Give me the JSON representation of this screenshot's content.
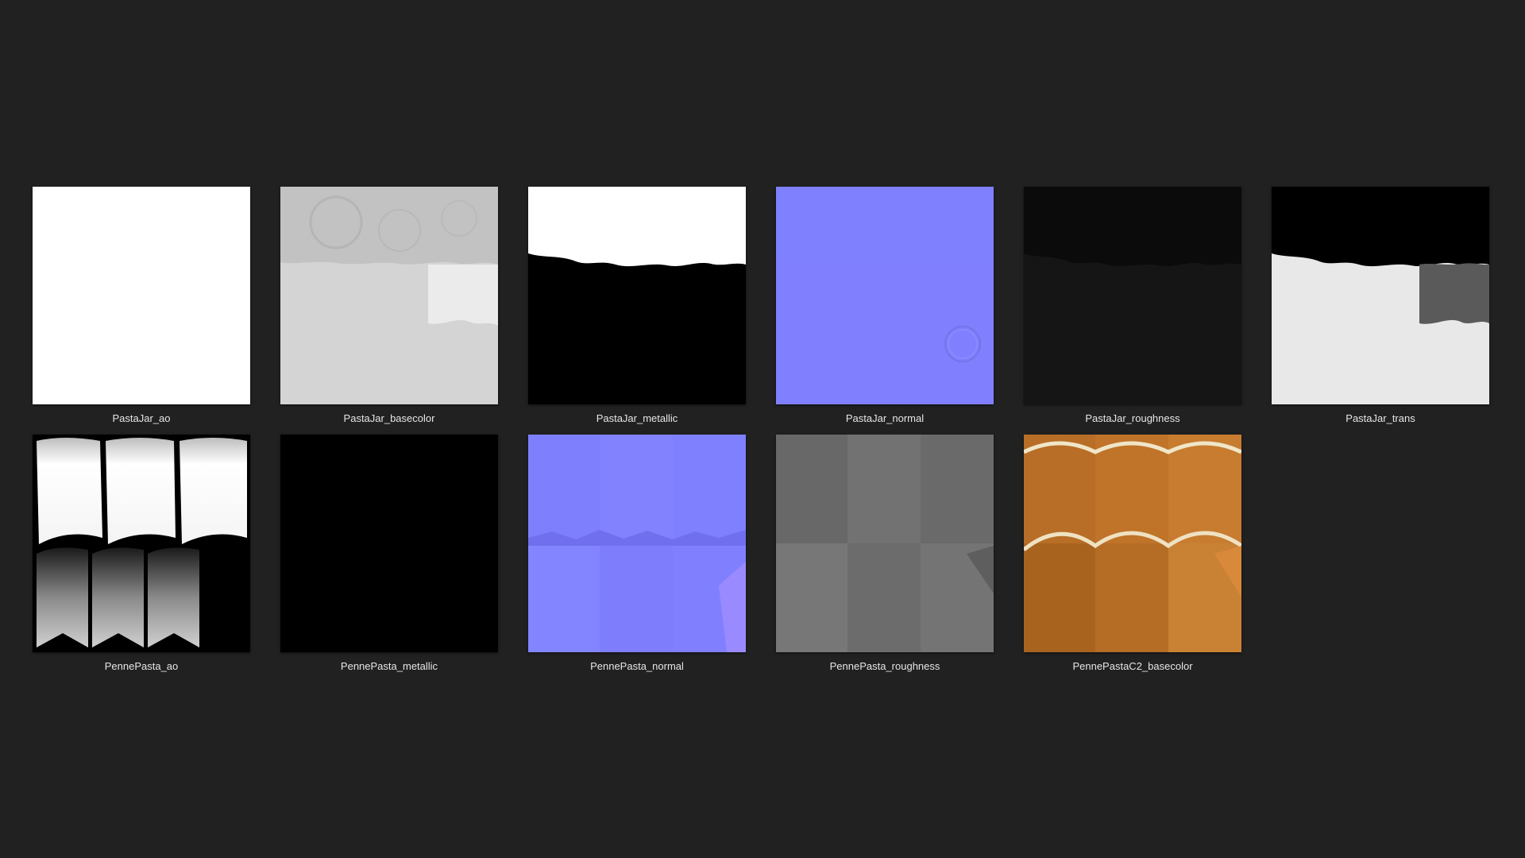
{
  "thumbnails": [
    {
      "label": "PastaJar_ao",
      "icon": "white-map-thumbnail"
    },
    {
      "label": "PastaJar_basecolor",
      "icon": "grey-basecolor-thumbnail"
    },
    {
      "label": "PastaJar_metallic",
      "icon": "black-white-metallic-thumbnail"
    },
    {
      "label": "PastaJar_normal",
      "icon": "blue-normal-map-thumbnail"
    },
    {
      "label": "PastaJar_roughness",
      "icon": "dark-roughness-thumbnail"
    },
    {
      "label": "PastaJar_trans",
      "icon": "translucency-map-thumbnail"
    },
    {
      "label": "PennePasta_ao",
      "icon": "penne-ao-thumbnail"
    },
    {
      "label": "PennePasta_metallic",
      "icon": "black-metallic-thumbnail"
    },
    {
      "label": "PennePasta_normal",
      "icon": "penne-normal-map-thumbnail"
    },
    {
      "label": "PennePasta_roughness",
      "icon": "grey-roughness-thumbnail"
    },
    {
      "label": "PennePastaC2_basecolor",
      "icon": "orange-pasta-basecolor-thumbnail"
    }
  ],
  "colors": {
    "background": "#212121",
    "label_text": "#e6e6e6",
    "normal_blue": "#8080ff",
    "pasta_orange": "#c47a2e"
  }
}
